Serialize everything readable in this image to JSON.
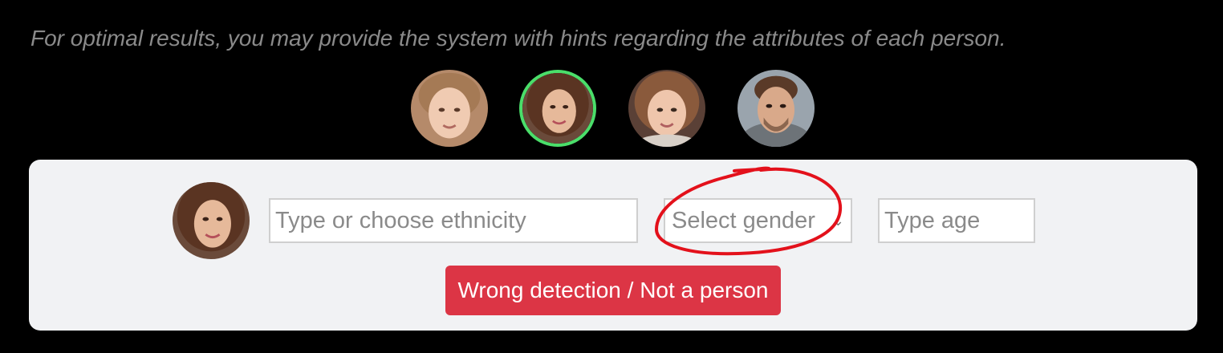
{
  "hint_text": "For optimal results, you may provide the system with hints regarding the attributes of each person.",
  "people": [
    {
      "name": "girl-1",
      "selected": false
    },
    {
      "name": "woman",
      "selected": true
    },
    {
      "name": "girl-2",
      "selected": false
    },
    {
      "name": "man",
      "selected": false
    }
  ],
  "form": {
    "ethnicity_placeholder": "Type or choose ethnicity",
    "gender_selected": "Select gender",
    "age_placeholder": "Type age",
    "wrong_detection_label": "Wrong detection / Not a person"
  },
  "colors": {
    "background": "#000000",
    "panel": "#f1f2f4",
    "selected_ring": "#4ade6a",
    "danger_button": "#dc3545",
    "annotation": "#e3111b"
  }
}
